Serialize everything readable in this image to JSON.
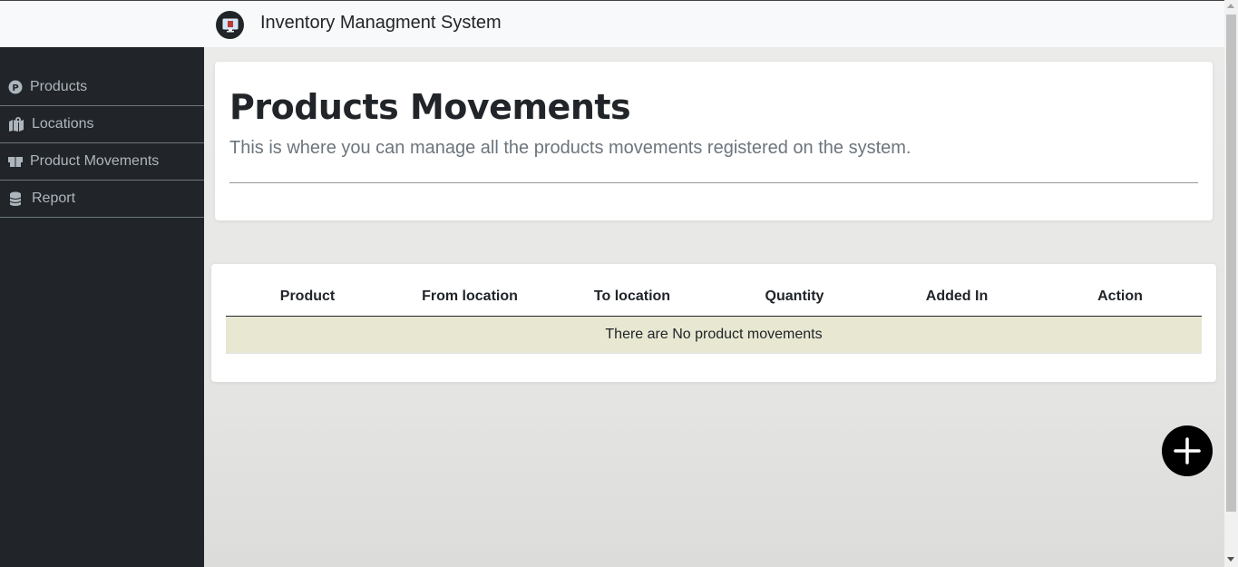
{
  "header": {
    "title": "Inventory Managment System",
    "logo_icon": "monitor-icon"
  },
  "sidebar": {
    "items": [
      {
        "label": "Products",
        "icon": "product-p-icon"
      },
      {
        "label": "Locations",
        "icon": "map-location-icon"
      },
      {
        "label": "Product Movements",
        "icon": "truck-movement-icon"
      },
      {
        "label": "Report",
        "icon": "database-icon"
      }
    ]
  },
  "main": {
    "heading": "Products Movements",
    "lead": "This is where you can manage all the products movements registered on the system.",
    "table": {
      "columns": [
        "Product",
        "From location",
        "To location",
        "Quantity",
        "Added In",
        "Action"
      ],
      "empty_message": "There are No product movements"
    },
    "add_button_icon": "plus-icon"
  },
  "colors": {
    "sidebar_bg": "#212529",
    "empty_row_bg": "#e8e8d2",
    "fab_bg": "#000000"
  }
}
